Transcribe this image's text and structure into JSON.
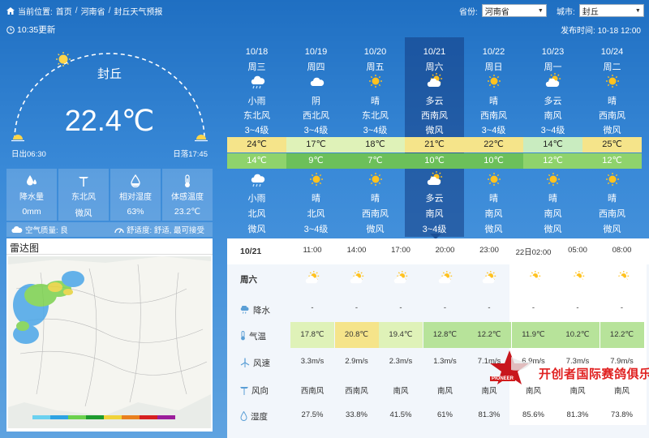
{
  "breadcrumb": {
    "prefix": "当前位置:",
    "items": [
      "首页",
      "河南省",
      "封丘天气预报"
    ],
    "sep": "/"
  },
  "selectors": {
    "province_label": "省份:",
    "province_value": "河南省",
    "city_label": "城市:",
    "city_value": "封丘"
  },
  "update_time": "10:35更新",
  "publish_time": "发布时间: 10-18 12:00",
  "current": {
    "city": "封丘",
    "temperature": "22.4℃",
    "sunrise": "日出06:30",
    "sunset": "日落17:45"
  },
  "stats": [
    {
      "label": "降水量",
      "value": "0mm",
      "icon": "raindrop-icon"
    },
    {
      "label": "东北风",
      "value": "微风",
      "icon": "wind-vane-icon"
    },
    {
      "label": "相对湿度",
      "value": "63%",
      "icon": "humidity-icon"
    },
    {
      "label": "体感温度",
      "value": "23.2℃",
      "icon": "thermometer-icon"
    }
  ],
  "air": {
    "aqi": "空气质量: 良",
    "comfort": "舒适度: 舒适, 最可接受"
  },
  "radar": {
    "title": "雷达图"
  },
  "daily": [
    {
      "date": "10/18",
      "week": "周三",
      "day_icon": "cloud-rain-icon",
      "day_wx": "小雨",
      "day_wind": "东北风",
      "day_ws": "3~4级",
      "hi": "24℃",
      "lo": "14℃",
      "night_icon": "cloud-rain-icon",
      "night_wx": "小雨",
      "night_wind": "北风",
      "night_ws": "微风",
      "hi_color": "#f5e48a",
      "lo_color": "#8fd36c"
    },
    {
      "date": "10/19",
      "week": "周四",
      "day_icon": "overcast-icon",
      "day_wx": "阴",
      "day_wind": "西北风",
      "day_ws": "3~4级",
      "hi": "17℃",
      "lo": "9℃",
      "night_icon": "sun-icon",
      "night_wx": "晴",
      "night_wind": "北风",
      "night_ws": "3~4级",
      "hi_color": "#dff2b8",
      "lo_color": "#6cc05a"
    },
    {
      "date": "10/20",
      "week": "周五",
      "day_icon": "sun-icon",
      "day_wx": "晴",
      "day_wind": "东北风",
      "day_ws": "3~4级",
      "hi": "18℃",
      "lo": "7℃",
      "night_icon": "sun-icon",
      "night_wx": "晴",
      "night_wind": "西南风",
      "night_ws": "微风",
      "hi_color": "#dff2b8",
      "lo_color": "#6cc05a"
    },
    {
      "date": "10/21",
      "week": "周六",
      "day_icon": "partly-cloudy-icon",
      "day_wx": "多云",
      "day_wind": "西南风",
      "day_ws": "微风",
      "hi": "21℃",
      "lo": "10℃",
      "night_icon": "partly-cloudy-icon",
      "night_wx": "多云",
      "night_wind": "南风",
      "night_ws": "3~4级",
      "hi_color": "#f5e48a",
      "lo_color": "#6cc05a"
    },
    {
      "date": "10/22",
      "week": "周日",
      "day_icon": "sun-icon",
      "day_wx": "晴",
      "day_wind": "西南风",
      "day_ws": "3~4级",
      "hi": "22℃",
      "lo": "10℃",
      "night_icon": "sun-icon",
      "night_wx": "晴",
      "night_wind": "南风",
      "night_ws": "微风",
      "hi_color": "#f5e48a",
      "lo_color": "#6cc05a"
    },
    {
      "date": "10/23",
      "week": "周一",
      "day_icon": "partly-cloudy-icon",
      "day_wx": "多云",
      "day_wind": "南风",
      "day_ws": "3~4级",
      "hi": "14℃",
      "lo": "12℃",
      "night_icon": "sun-icon",
      "night_wx": "晴",
      "night_wind": "南风",
      "night_ws": "微风",
      "hi_color": "#c9ecc0",
      "lo_color": "#8fd36c"
    },
    {
      "date": "10/24",
      "week": "周二",
      "day_icon": "sun-icon",
      "day_wx": "晴",
      "day_wind": "西南风",
      "day_ws": "微风",
      "hi": "25℃",
      "lo": "12℃",
      "night_icon": "sun-icon",
      "night_wx": "晴",
      "night_wind": "西南风",
      "night_ws": "微风",
      "hi_color": "#f5e48a",
      "lo_color": "#8fd36c"
    }
  ],
  "hourly": {
    "date": "10/21",
    "week": "周六",
    "times": [
      "11:00",
      "14:00",
      "17:00",
      "20:00",
      "23:00",
      "22日02:00",
      "05:00",
      "08:00"
    ],
    "icons": [
      "partly-cloudy-icon",
      "partly-cloudy-icon",
      "partly-cloudy-icon",
      "partly-cloudy-icon",
      "partly-cloudy-icon",
      "partly-cloudy-icon",
      "partly-cloudy-icon",
      "partly-cloudy-icon"
    ],
    "labels": {
      "rain": "降水",
      "temp": "气温",
      "wind_speed": "风速",
      "wind_dir": "风向",
      "humidity": "湿度"
    },
    "rain": [
      "-",
      "-",
      "-",
      "-",
      "-",
      "-",
      "-",
      "-"
    ],
    "temp": [
      "17.8℃",
      "20.8℃",
      "19.4℃",
      "12.8℃",
      "12.2℃",
      "11.9℃",
      "10.2℃",
      "12.2℃"
    ],
    "temp_colors": [
      "#dff2b8",
      "#f5e48a",
      "#dff2b8",
      "#b7e39a",
      "#b7e39a",
      "#b7e39a",
      "#b7e39a",
      "#b7e39a"
    ],
    "wind_speed": [
      "3.3m/s",
      "2.9m/s",
      "2.3m/s",
      "1.3m/s",
      "7.1m/s",
      "6.9m/s",
      "7.3m/s",
      "7.9m/s"
    ],
    "wind_dir": [
      "西南风",
      "西南风",
      "南风",
      "南风",
      "南风",
      "南风",
      "南风",
      "南风"
    ],
    "humidity": [
      "27.5%",
      "33.8%",
      "41.5%",
      "61%",
      "81.3%",
      "85.6%",
      "81.3%",
      "73.8%"
    ]
  },
  "watermark": {
    "text": "开创者国际赛鸽俱乐部",
    "sub": "PIONEER"
  }
}
